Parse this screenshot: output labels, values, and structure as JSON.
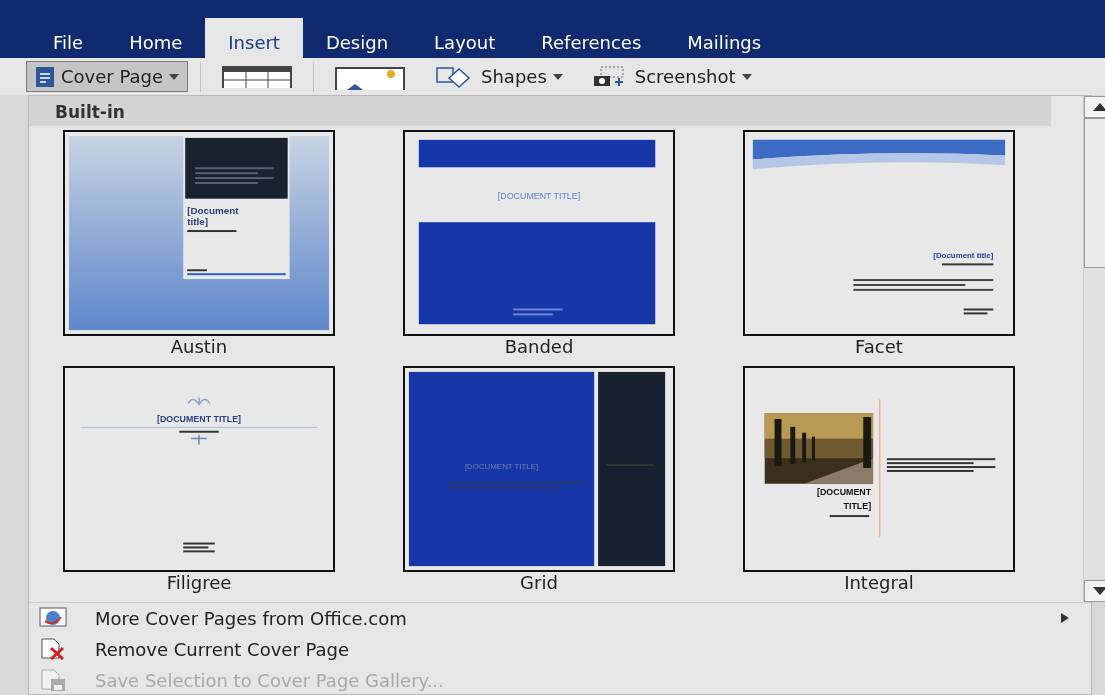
{
  "tabs": [
    {
      "label": "File",
      "selected": false
    },
    {
      "label": "Home",
      "selected": false
    },
    {
      "label": "Insert",
      "selected": true
    },
    {
      "label": "Design",
      "selected": false
    },
    {
      "label": "Layout",
      "selected": false
    },
    {
      "label": "References",
      "selected": false
    },
    {
      "label": "Mailings",
      "selected": false
    }
  ],
  "ribbon": [
    {
      "kind": "cover",
      "label": "Cover Page",
      "pressed": true
    },
    {
      "kind": "table"
    },
    {
      "kind": "picture"
    },
    {
      "kind": "shapes",
      "label": "Shapes",
      "pressed": false
    },
    {
      "kind": "screenshot",
      "label": "Screenshot",
      "pressed": false
    }
  ],
  "gallery": {
    "header": "Built-in",
    "items": [
      {
        "kind": "austin",
        "name": "Austin",
        "title": "[Document title]"
      },
      {
        "kind": "banded",
        "name": "Banded",
        "title": "[DOCUMENT TITLE]"
      },
      {
        "kind": "facet",
        "name": "Facet",
        "title": "[Document title]"
      },
      {
        "kind": "filigree",
        "name": "Filigree",
        "title": "[DOCUMENT TITLE]"
      },
      {
        "kind": "grid",
        "name": "Grid",
        "title": "[DOCUMENT TITLE]"
      },
      {
        "kind": "integral",
        "name": "Integral",
        "title": "[DOCUMENT TITLE]"
      }
    ]
  },
  "menu": [
    {
      "kind": "globe",
      "label": "More Cover Pages from Office.com",
      "submenu": true,
      "disabled": false
    },
    {
      "kind": "remove",
      "label": "Remove Current Cover Page",
      "submenu": false,
      "disabled": false
    },
    {
      "kind": "save",
      "label": "Save Selection to Cover Page Gallery...",
      "submenu": false,
      "disabled": true
    }
  ]
}
